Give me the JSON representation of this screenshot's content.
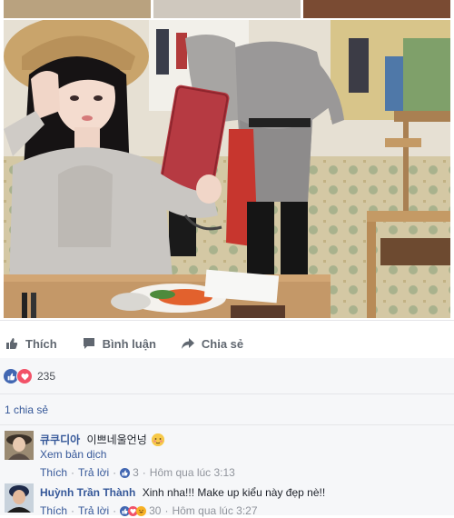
{
  "actions": {
    "like_label": "Thích",
    "comment_label": "Bình luận",
    "share_label": "Chia sẻ"
  },
  "reactions": {
    "count": "235",
    "icons": [
      "like-reaction-icon",
      "love-reaction-icon"
    ]
  },
  "shares": {
    "label": "1 chia sẻ"
  },
  "comments": [
    {
      "author": "큐쿠디아",
      "text": "이쁘네울언넝",
      "emoji": "blushing-face-icon",
      "translate_label": "Xem bản dịch",
      "like_label": "Thích",
      "reply_label": "Trả lời",
      "reaction_count": "3",
      "timestamp": "Hôm qua lúc 3:13"
    },
    {
      "author": "Huỳnh Trần Thành",
      "text": "Xinh nha!!! Make up kiểu này đẹp nè!!",
      "like_label": "Thích",
      "reply_label": "Trả lời",
      "reaction_count": "30",
      "timestamp": "Hôm qua lúc 3:27"
    }
  ],
  "colors": {
    "link_blue": "#365899",
    "like_blue": "#4267b2",
    "love_red": "#f25268",
    "meta_gray": "#90949c",
    "panel_bg": "#f6f7f9"
  }
}
